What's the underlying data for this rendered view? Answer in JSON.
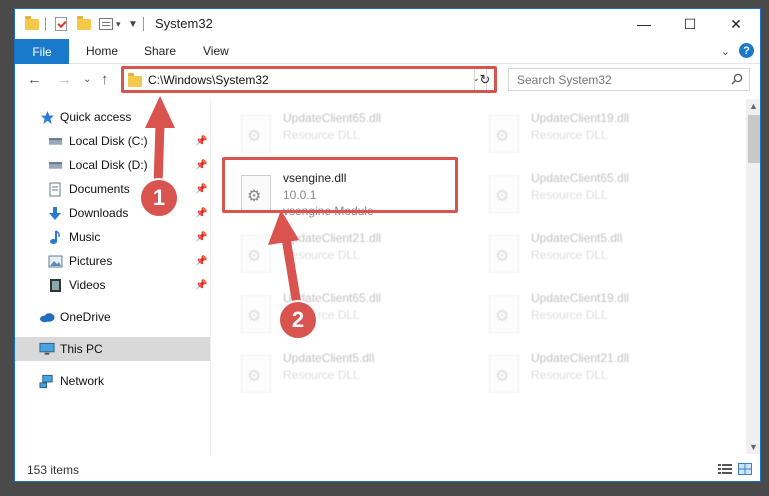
{
  "window": {
    "title": "System32",
    "minimize": "—",
    "maximize": "☐",
    "close": "✕"
  },
  "ribbon": {
    "tabs": [
      "File",
      "Home",
      "Share",
      "View"
    ],
    "expand_chevron": "⌄",
    "help": "?"
  },
  "nav": {
    "back": "←",
    "forward": "→",
    "recent": "⌄",
    "up": "↑",
    "address": "C:\\Windows\\System32",
    "refresh": "↻",
    "search_placeholder": "Search System32"
  },
  "sidebar": {
    "items": [
      {
        "label": "Quick access",
        "icon": "star-icon",
        "pinned": false
      },
      {
        "label": "Local Disk (C:)",
        "icon": "drive-icon",
        "pinned": true
      },
      {
        "label": "Local Disk (D:)",
        "icon": "drive-icon",
        "pinned": true
      },
      {
        "label": "Documents",
        "icon": "document-icon",
        "pinned": true
      },
      {
        "label": "Downloads",
        "icon": "download-icon",
        "pinned": true
      },
      {
        "label": "Music",
        "icon": "music-icon",
        "pinned": true
      },
      {
        "label": "Pictures",
        "icon": "picture-icon",
        "pinned": true
      },
      {
        "label": "Videos",
        "icon": "video-icon",
        "pinned": true
      },
      {
        "label": "OneDrive",
        "icon": "cloud-icon",
        "pinned": false
      },
      {
        "label": "This PC",
        "icon": "computer-icon",
        "pinned": false,
        "selected": true
      },
      {
        "label": "Network",
        "icon": "network-icon",
        "pinned": false
      }
    ]
  },
  "files": {
    "highlighted": {
      "name": "vsengine.dll",
      "version": "10.0.1",
      "description": "vsengine Module"
    },
    "background": [
      {
        "name": "UpdateClient65.dll",
        "type": "Resource DLL"
      },
      {
        "name": "UpdateClient19.dll",
        "type": "Resource DLL"
      },
      {
        "name": "UpdateClient65.dll",
        "type": "Resource DLL"
      },
      {
        "name": "UpdateClient21.dll",
        "type": "Resource DLL"
      },
      {
        "name": "UpdateClient5.dll",
        "type": "Resource DLL"
      },
      {
        "name": "UpdateClient65.dll",
        "type": "Resource DLL"
      },
      {
        "name": "UpdateClient19.dll",
        "type": "Resource DLL"
      },
      {
        "name": "UpdateClient5.dll",
        "type": "Resource DLL"
      },
      {
        "name": "UpdateClient21.dll",
        "type": "Resource DLL"
      }
    ]
  },
  "status": {
    "item_count": "153 items"
  },
  "annotations": {
    "step1": "1",
    "step2": "2",
    "color": "#d9534f"
  }
}
